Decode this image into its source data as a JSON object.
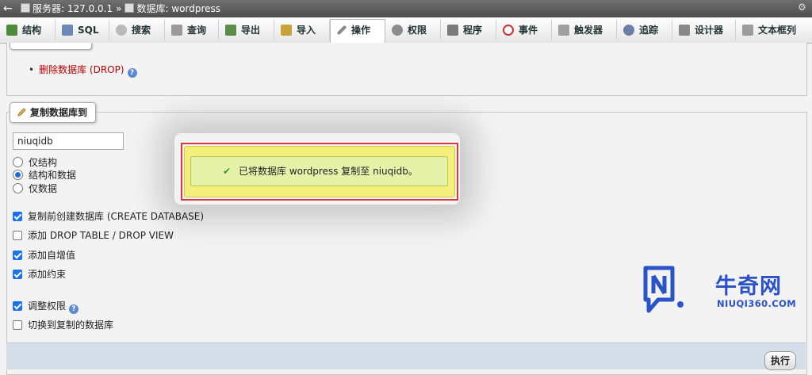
{
  "topbar": {
    "server": "服务器: 127.0.0.1",
    "separator": "»",
    "database": "数据库: wordpress"
  },
  "tabs": [
    {
      "label": "结构",
      "icon": "structure-icon"
    },
    {
      "label": "SQL",
      "icon": "sql-icon"
    },
    {
      "label": "搜索",
      "icon": "search-icon"
    },
    {
      "label": "查询",
      "icon": "query-icon"
    },
    {
      "label": "导出",
      "icon": "export-icon"
    },
    {
      "label": "导入",
      "icon": "import-icon"
    },
    {
      "label": "操作",
      "icon": "wrench-icon",
      "active": true
    },
    {
      "label": "权限",
      "icon": "privileges-icon"
    },
    {
      "label": "程序",
      "icon": "routines-icon"
    },
    {
      "label": "事件",
      "icon": "clock-icon"
    },
    {
      "label": "触发器",
      "icon": "triggers-icon"
    },
    {
      "label": "追踪",
      "icon": "eye-icon"
    },
    {
      "label": "设计器",
      "icon": "designer-icon"
    },
    {
      "label": "文本框列",
      "icon": "text-columns-icon"
    }
  ],
  "drop": {
    "label": "删除数据库 (DROP)"
  },
  "copy": {
    "legend": "复制数据库到",
    "db_name_value": "niuqidb",
    "radios": [
      {
        "label": "仅结构",
        "checked": false
      },
      {
        "label": "结构和数据",
        "checked": true
      },
      {
        "label": "仅数据",
        "checked": false
      }
    ],
    "checkboxes": [
      {
        "label": "复制前创建数据库 (CREATE DATABASE)",
        "checked": true
      },
      {
        "label": "添加 DROP TABLE / DROP VIEW",
        "checked": false
      },
      {
        "label": "添加自增值",
        "checked": true
      },
      {
        "label": "添加约束",
        "checked": true
      },
      {
        "label": "调整权限",
        "checked": true
      },
      {
        "label": "切换到复制的数据库",
        "checked": false
      }
    ],
    "execute_label": "执行"
  },
  "notification": {
    "message": "已将数据库 wordpress 复制至 niuqidb。"
  },
  "watermark": {
    "cn": "牛奇网",
    "en": "NIUQI360.COM"
  },
  "colors": {
    "danger": "#bb0000",
    "success_bg": "#e6f2a8",
    "popup_bg": "#f4ee7a",
    "highlight_outline": "#d53b3b",
    "brand": "#2a52c9"
  }
}
